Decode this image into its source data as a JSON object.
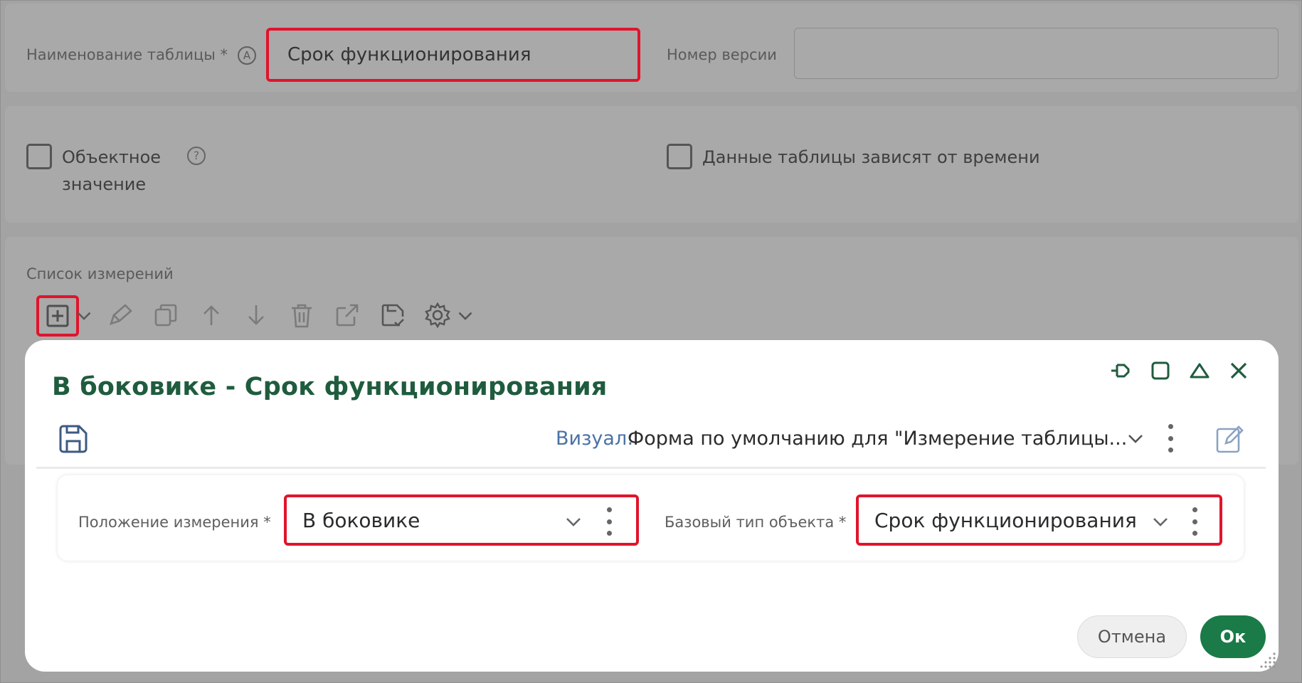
{
  "background": {
    "table_name_label": "Наименование таблицы *",
    "table_name_value": "Срок функционирования",
    "version_label": "Номер версии",
    "version_value": "",
    "object_value_label_line1": "Объектное",
    "object_value_label_line2": "значение",
    "time_dependent_label": "Данные таблицы зависят от времени",
    "dimensions_list_label": "Список измерений",
    "a_badge": "A",
    "help_badge": "?"
  },
  "modal": {
    "title": "В боковике - Срок функционирования",
    "visual_label": "Визуал:",
    "visual_value": "Форма по умолчанию для \"Измерение таблицы...",
    "position_label": "Положение измерения *",
    "position_value": "В боковике",
    "base_type_label": "Базовый тип объекта *",
    "base_type_value": "Срок функционирования",
    "cancel_label": "Отмена",
    "ok_label": "Ок"
  },
  "colors": {
    "accent_green": "#1a7a48",
    "title_green": "#1f5c3e",
    "highlight_red": "#e0142b",
    "visual_label_blue": "#4b72a4"
  },
  "icons": {
    "toolbar": [
      "add-icon",
      "dropdown-chevron-icon",
      "pencil-icon",
      "copy-icon",
      "arrow-up-icon",
      "arrow-down-icon",
      "trash-icon",
      "external-link-icon",
      "save-check-icon",
      "gear-icon"
    ],
    "window_controls": [
      "pin-icon",
      "maximize-icon",
      "collapse-icon",
      "close-icon"
    ]
  }
}
